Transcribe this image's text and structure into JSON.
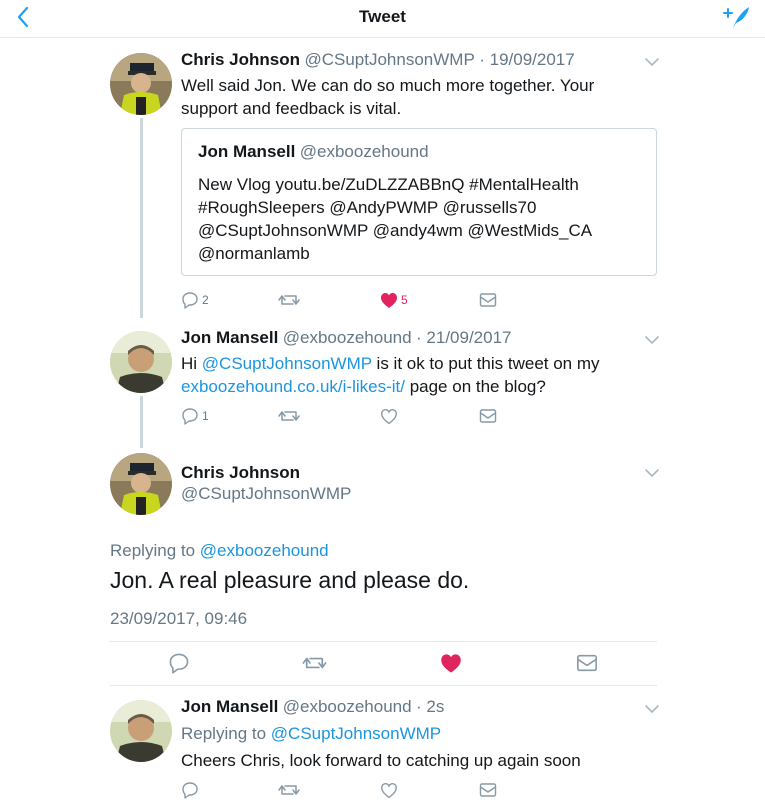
{
  "nav": {
    "title": "Tweet"
  },
  "tweets": [
    {
      "name": "Chris Johnson",
      "handle": "@CSuptJohnsonWMP",
      "date": "· 19/09/2017",
      "text": "Well said Jon. We can do so much more together. Your support and feedback is vital.",
      "quote": {
        "name": "Jon Mansell",
        "handle": "@exboozehound",
        "text": "New Vlog youtu.be/ZuDLZZABBnQ #MentalHealth #RoughSleepers @AndyPWMP @russells70 @CSuptJohnsonWMP @andy4wm @WestMids_CA @normanlamb"
      },
      "replies": "2",
      "likes": "5"
    },
    {
      "name": "Jon Mansell",
      "handle": "@exboozehound",
      "date": "· 21/09/2017",
      "text_pre": "Hi ",
      "mention": "@CSuptJohnsonWMP",
      "text_mid": " is it ok to put this tweet on my",
      "link": "exboozehound.co.uk/i-likes-it/",
      "text_post": " page on the blog?",
      "replies": "1"
    }
  ],
  "focused": {
    "name": "Chris Johnson",
    "handle": "@CSuptJohnsonWMP",
    "replying_label": "Replying to",
    "replying_to": "@exboozehound",
    "text": "Jon.  A real pleasure and please do.",
    "timestamp": "23/09/2017, 09:46"
  },
  "reply": {
    "name": "Jon Mansell",
    "handle": "@exboozehound",
    "age": "· 2s",
    "replying_label": "Replying to",
    "replying_to": "@CSuptJohnsonWMP",
    "text": "Cheers Chris, look forward to catching up again soon"
  },
  "colors": {
    "accent": "#1b95e0",
    "like": "#e0245e",
    "muted": "#657786",
    "icon": "#8899a6"
  }
}
